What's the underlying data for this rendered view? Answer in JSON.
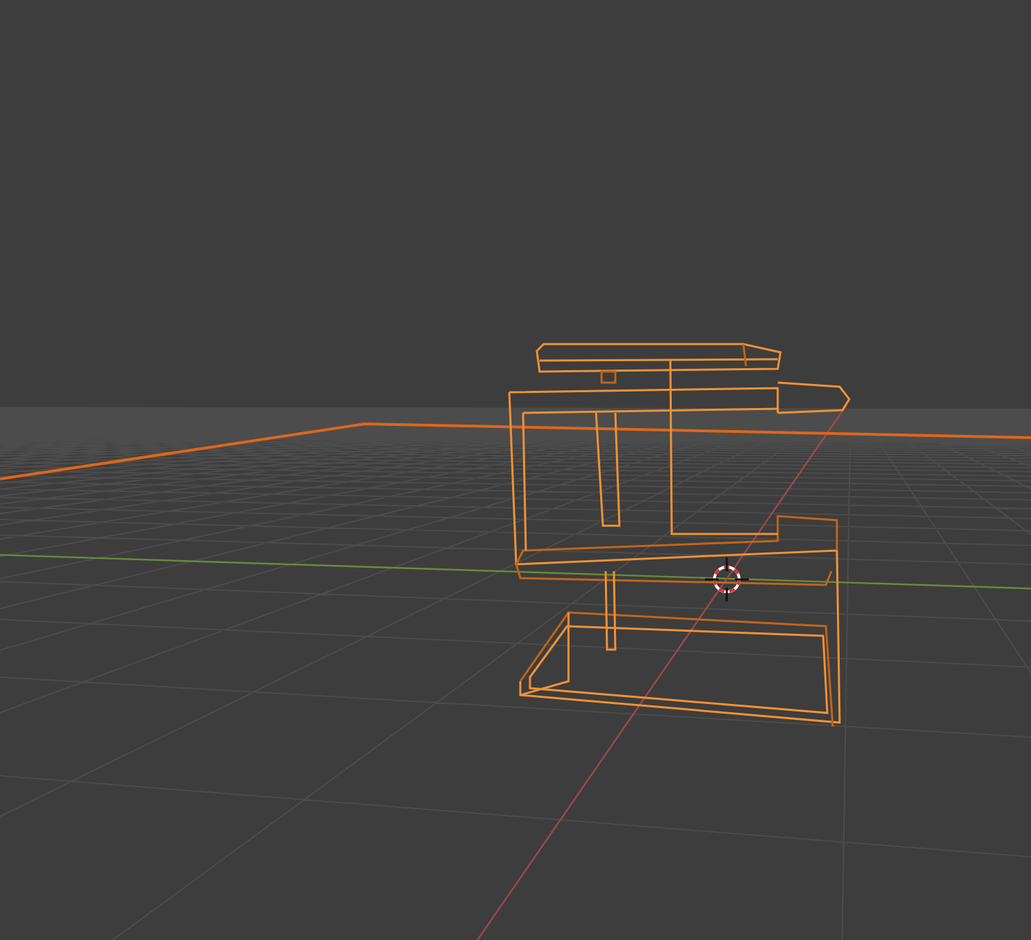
{
  "scene": {
    "object": {
      "selected": true
    }
  }
}
